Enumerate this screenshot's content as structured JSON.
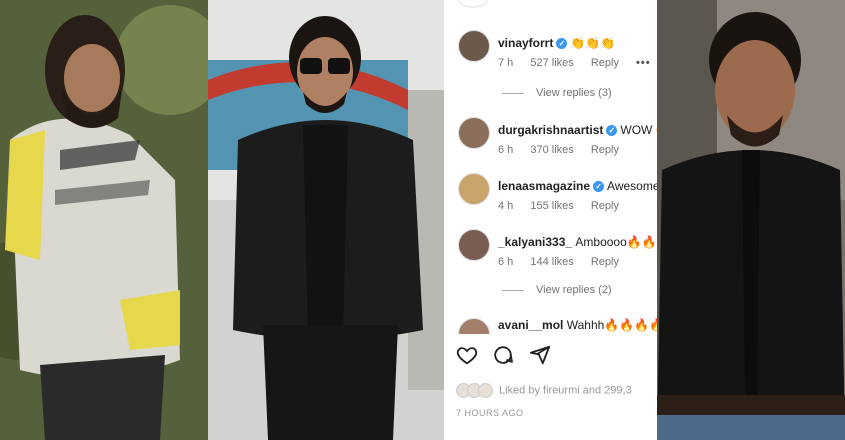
{
  "comments": [
    {
      "username": "vinayforrt",
      "verified": true,
      "text": "👏👏👏",
      "time": "7 h",
      "likes": "527 likes",
      "reply": "Reply",
      "more": "•••"
    },
    {
      "username": "durgakrishnaartist",
      "verified": true,
      "text": "WOW 😊",
      "time": "6 h",
      "likes": "370 likes",
      "reply": "Reply"
    },
    {
      "username": "lenaasmagazine",
      "verified": true,
      "text": "Awesome",
      "time": "4 h",
      "likes": "155 likes",
      "reply": "Reply"
    },
    {
      "username": "_kalyani333_",
      "verified": false,
      "text": "Amboooo🔥🔥🔥",
      "time": "6 h",
      "likes": "144 likes",
      "reply": "Reply"
    },
    {
      "username": "avani__mol",
      "verified": false,
      "text": "Wahhh🔥🔥🔥🔥"
    }
  ],
  "view_replies": [
    "View replies (3)",
    "View replies (2)"
  ],
  "liked_by": "Liked by fireurmi and 299,3",
  "time_ago": "7 HOURS AGO",
  "icons": [
    "heart-icon",
    "comment-icon",
    "share-icon"
  ]
}
